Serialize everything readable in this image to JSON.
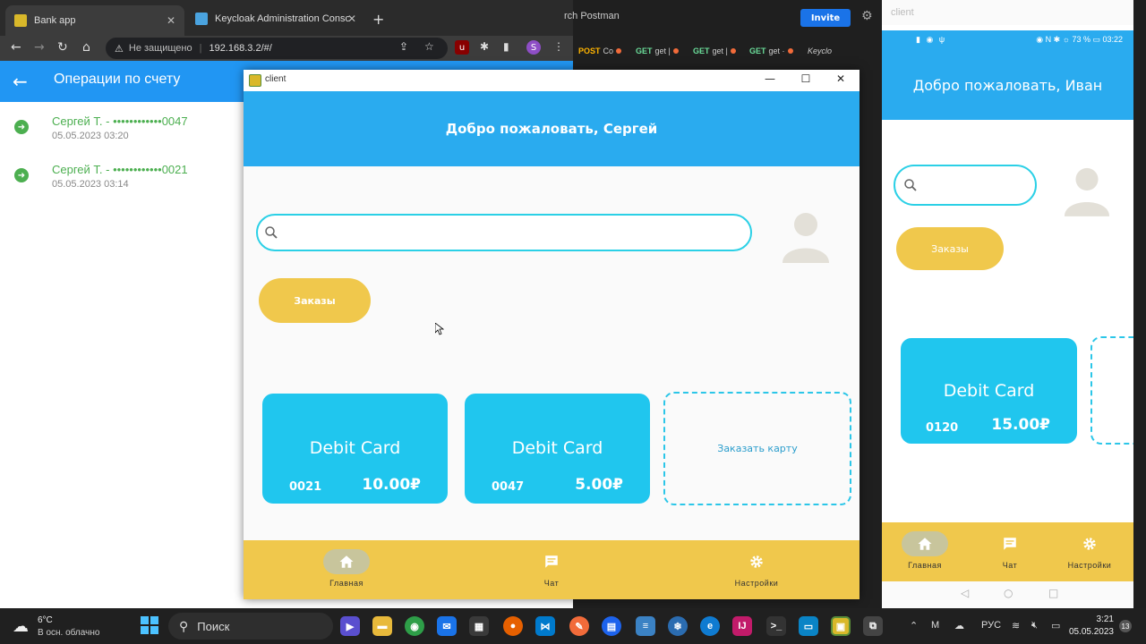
{
  "browser": {
    "tabs": [
      {
        "title": "Bank app",
        "active": true
      },
      {
        "title": "Keycloak Administration Console",
        "active": false
      }
    ],
    "url_warning": "Не защищено",
    "url": "192.168.3.2/#/",
    "profile_letter": "S"
  },
  "operations_page": {
    "title": "Операции по счету",
    "items": [
      {
        "name": "Сергей Т. - ••••••••••••0047",
        "date": "05.05.2023 03:20"
      },
      {
        "name": "Сергей Т. - ••••••••••••0021",
        "date": "05.05.2023 03:14"
      }
    ]
  },
  "postman": {
    "search_text": "rch Postman",
    "invite_label": "Invite",
    "tabs": [
      {
        "method": "POST",
        "name": "Co"
      },
      {
        "method": "GET",
        "name": "get |"
      },
      {
        "method": "GET",
        "name": "get |"
      },
      {
        "method": "GET",
        "name": "get ·"
      },
      {
        "method": "",
        "name": "Keyclo"
      }
    ]
  },
  "client_window": {
    "title": "client",
    "header": "Добро пожаловать, Сергей",
    "search_placeholder": "",
    "orders_label": "Заказы",
    "cards": [
      {
        "type": "Debit Card",
        "number": "0021",
        "balance": "10.00₽"
      },
      {
        "type": "Debit Card",
        "number": "0047",
        "balance": "5.00₽"
      }
    ],
    "order_card_label": "Заказать карту",
    "nav": [
      {
        "label": "Главная",
        "icon": "home-icon",
        "selected": true
      },
      {
        "label": "Чат",
        "icon": "chat-icon",
        "selected": false
      },
      {
        "label": "Настройки",
        "icon": "settings-icon",
        "selected": false
      }
    ]
  },
  "phone": {
    "window_title": "client",
    "status_right": "73 %",
    "status_time": "03:22",
    "header": "Добро пожаловать, Иван",
    "orders_label": "Заказы",
    "card": {
      "type": "Debit Card",
      "number": "0120",
      "balance": "15.00₽"
    },
    "nav": [
      {
        "label": "Главная"
      },
      {
        "label": "Чат"
      },
      {
        "label": "Настройки"
      }
    ]
  },
  "taskbar": {
    "temperature": "6°C",
    "weather_desc": "В осн. облачно",
    "search_label": "Поиск",
    "language": "РУС",
    "time": "3:21",
    "date": "05.05.2023",
    "notifications": "13"
  },
  "colors": {
    "primary_blue": "#2aabef",
    "card_cyan": "#20c6ee",
    "accent_yellow": "#f0c84c",
    "success_green": "#4caf50"
  }
}
